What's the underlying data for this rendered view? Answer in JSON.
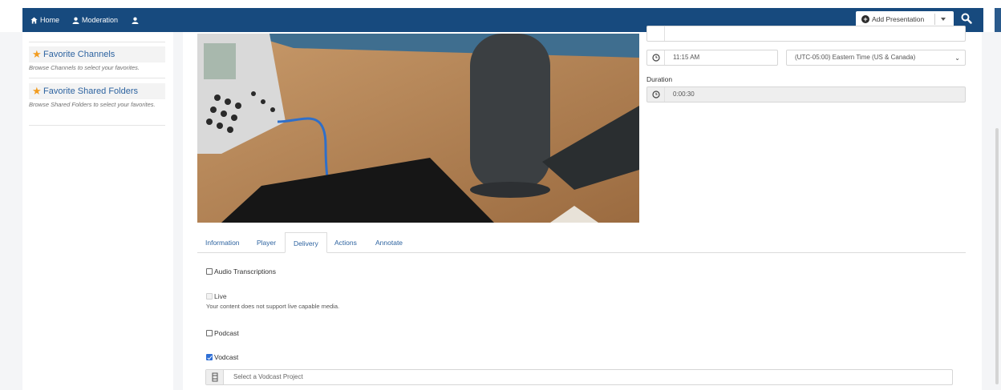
{
  "nav": {
    "home": "Home",
    "moderation": "Moderation",
    "add_presentation": "Add Presentation"
  },
  "sidebar": {
    "favorites": [
      {
        "title": "Favorite Channels",
        "description": "Browse Channels to select your favorites."
      },
      {
        "title": "Favorite Shared Folders",
        "description": "Browse Shared Folders to select your favorites."
      }
    ]
  },
  "schedule": {
    "time": "11:15 AM",
    "timezone": "(UTC-05:00) Eastern Time (US & Canada)",
    "duration_label": "Duration",
    "duration": "0:00:30"
  },
  "tabs": [
    "Information",
    "Player",
    "Delivery",
    "Actions",
    "Annotate"
  ],
  "active_tab": "Delivery",
  "delivery": {
    "audio_transcriptions": {
      "label": "Audio Transcriptions",
      "checked": false
    },
    "live": {
      "label": "Live",
      "note": "Your content does not support live capable media.",
      "enabled": false
    },
    "podcast": {
      "label": "Podcast",
      "checked": false
    },
    "vodcast": {
      "label": "Vodcast",
      "checked": true
    },
    "vodcast_project_placeholder": "Select a Vodcast Project"
  },
  "colors": {
    "nav_bg": "#174a7e",
    "link": "#2d63a0",
    "star": "#f29c1f",
    "checkbox_checked": "#2f6fd6"
  },
  "icons": [
    "home-icon",
    "user-icon",
    "plus-circle-icon",
    "search-icon",
    "star-icon",
    "calendar-icon",
    "clock-icon",
    "film-icon"
  ]
}
